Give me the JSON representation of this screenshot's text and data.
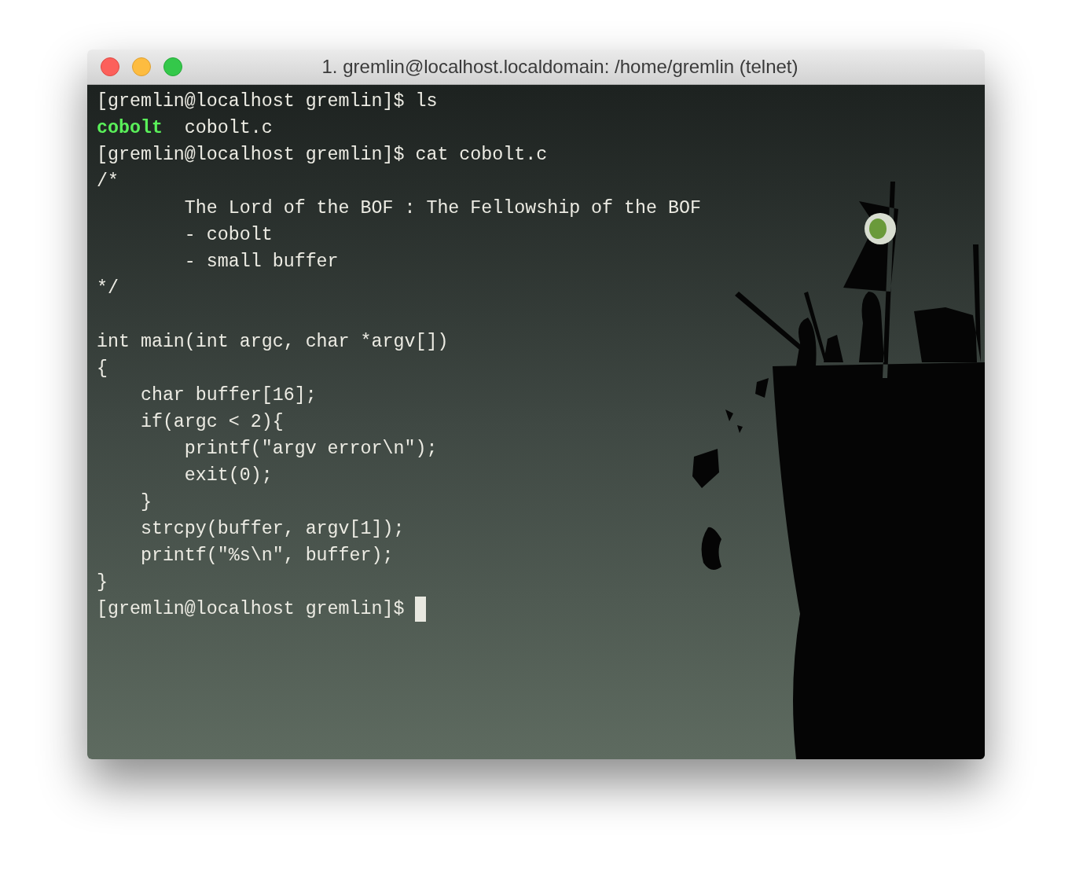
{
  "window": {
    "title": "1. gremlin@localhost.localdomain: /home/gremlin (telnet)"
  },
  "terminal": {
    "lines": [
      {
        "kind": "text",
        "segments": [
          {
            "kind": "plain",
            "text": "[gremlin@localhost gremlin]$ ls"
          }
        ]
      },
      {
        "kind": "text",
        "segments": [
          {
            "kind": "exec",
            "text": "cobolt"
          },
          {
            "kind": "plain",
            "text": "  cobolt.c"
          }
        ]
      },
      {
        "kind": "text",
        "segments": [
          {
            "kind": "plain",
            "text": "[gremlin@localhost gremlin]$ cat cobolt.c"
          }
        ]
      },
      {
        "kind": "text",
        "segments": [
          {
            "kind": "plain",
            "text": "/*"
          }
        ]
      },
      {
        "kind": "text",
        "segments": [
          {
            "kind": "plain",
            "text": "        The Lord of the BOF : The Fellowship of the BOF"
          }
        ]
      },
      {
        "kind": "text",
        "segments": [
          {
            "kind": "plain",
            "text": "        - cobolt"
          }
        ]
      },
      {
        "kind": "text",
        "segments": [
          {
            "kind": "plain",
            "text": "        - small buffer"
          }
        ]
      },
      {
        "kind": "text",
        "segments": [
          {
            "kind": "plain",
            "text": "*/"
          }
        ]
      },
      {
        "kind": "blank"
      },
      {
        "kind": "text",
        "segments": [
          {
            "kind": "plain",
            "text": "int main(int argc, char *argv[])"
          }
        ]
      },
      {
        "kind": "text",
        "segments": [
          {
            "kind": "plain",
            "text": "{"
          }
        ]
      },
      {
        "kind": "text",
        "segments": [
          {
            "kind": "plain",
            "text": "    char buffer[16];"
          }
        ]
      },
      {
        "kind": "text",
        "segments": [
          {
            "kind": "plain",
            "text": "    if(argc < 2){"
          }
        ]
      },
      {
        "kind": "text",
        "segments": [
          {
            "kind": "plain",
            "text": "        printf(\"argv error\\n\");"
          }
        ]
      },
      {
        "kind": "text",
        "segments": [
          {
            "kind": "plain",
            "text": "        exit(0);"
          }
        ]
      },
      {
        "kind": "text",
        "segments": [
          {
            "kind": "plain",
            "text": "    }"
          }
        ]
      },
      {
        "kind": "text",
        "segments": [
          {
            "kind": "plain",
            "text": "    strcpy(buffer, argv[1]);"
          }
        ]
      },
      {
        "kind": "text",
        "segments": [
          {
            "kind": "plain",
            "text": "    printf(\"%s\\n\", buffer);"
          }
        ]
      },
      {
        "kind": "text",
        "segments": [
          {
            "kind": "plain",
            "text": "}"
          }
        ]
      },
      {
        "kind": "prompt",
        "segments": [
          {
            "kind": "plain",
            "text": "[gremlin@localhost gremlin]$ "
          }
        ]
      }
    ]
  }
}
